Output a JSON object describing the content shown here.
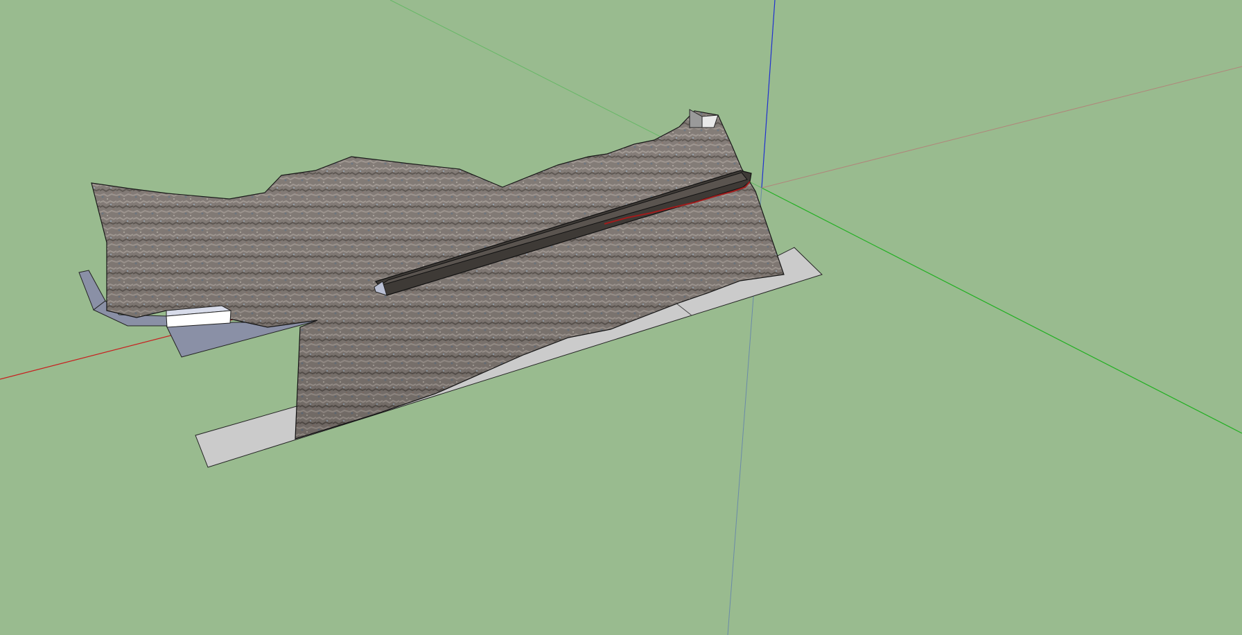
{
  "app": {
    "kind": "3d-modeling-viewport",
    "visible_text": []
  },
  "viewport": {
    "background_color": "#99bb8f",
    "axis_colors": {
      "x_axis": "#c81e1e",
      "y_axis": "#22b022",
      "z_axis": "#1f2fd0",
      "x_axis_hidden": "#b0857a",
      "y_axis_hidden": "#66b866",
      "z_axis_hidden": "#6a8aa8"
    },
    "model_colors": {
      "rock_texture_base": "#7d7570",
      "rock_texture_light": "#a49b94",
      "rock_texture_dark": "#4c4641",
      "ground_plate": "#cbcbcb",
      "blue_grey_walls": "#8a90a6",
      "white_block": "#ffffff",
      "edge_lines": "#111111",
      "channel_dark": "#3e3a36",
      "red_path": "#a01c1c"
    }
  }
}
